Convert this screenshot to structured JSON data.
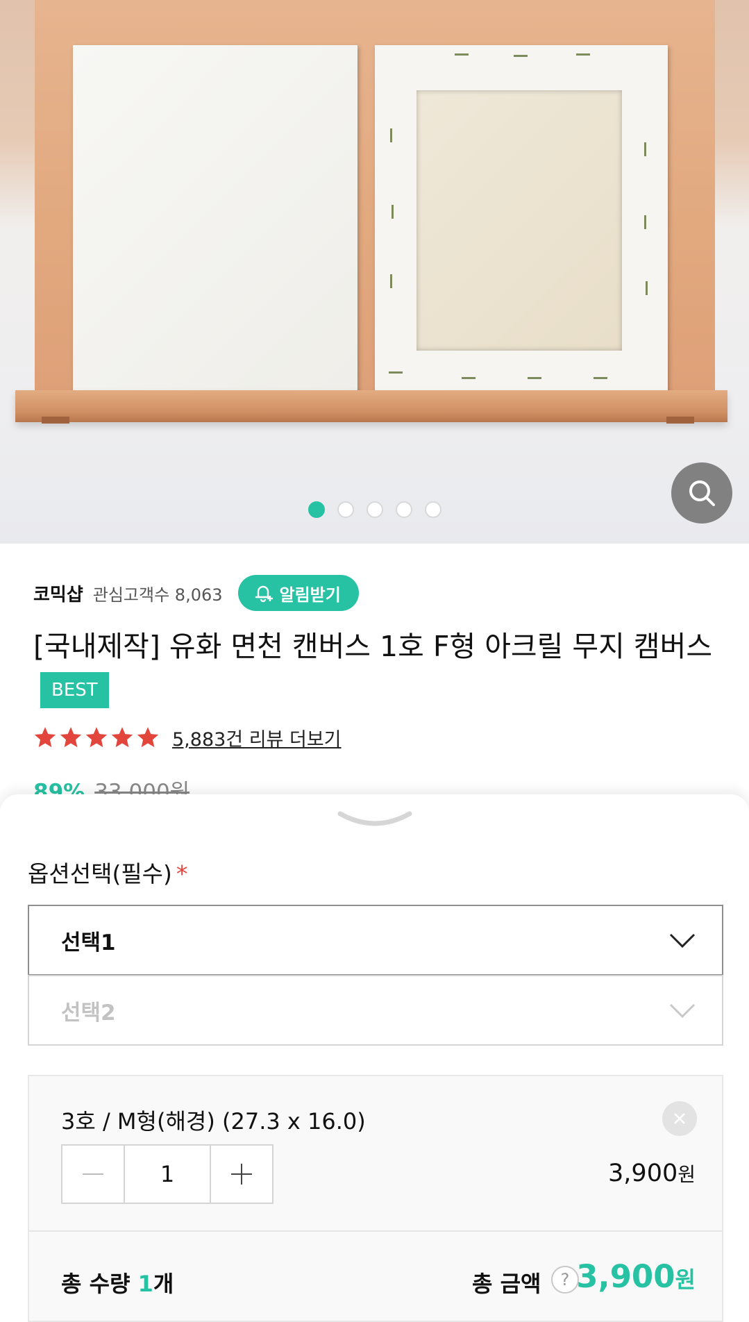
{
  "gallery": {
    "slide_count": 5,
    "active_slide": 1,
    "zoom_icon": "search-icon"
  },
  "shop": {
    "name": "코믹샵",
    "follower_label": "관심고객수 8,063",
    "alarm_label": "알림받기",
    "alarm_icon": "bell-plus-icon"
  },
  "product": {
    "title": "[국내제작] 유화 면천 캔버스 1호 F형 아크릴 무지 캠버스",
    "badge": "BEST",
    "rating_stars": 5,
    "review_link": "5,883건 리뷰 더보기",
    "discount": "89%",
    "original_price": "33,000원"
  },
  "option_sheet": {
    "label": "옵션선택(필수)",
    "required_mark": "*",
    "select1": "선택1",
    "select2": "선택2",
    "selected_item": {
      "name": "3호 / M형(해경) (27.3 x 16.0)",
      "quantity": "1",
      "price": "3,900",
      "price_unit": "원"
    },
    "total_qty_label": "총 수량",
    "total_qty": "1",
    "total_qty_unit": "개",
    "total_amount_label": "총 금액",
    "help": "?",
    "total_amount": "3,900",
    "total_amount_unit": "원"
  },
  "colors": {
    "accent": "#27c2a3",
    "star": "#e2453c"
  }
}
